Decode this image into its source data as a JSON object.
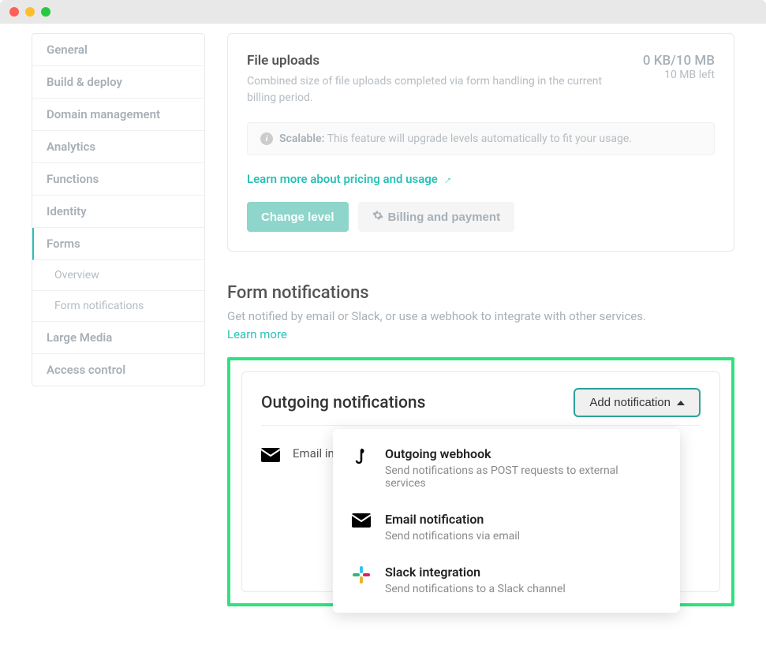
{
  "sidebar": {
    "items": [
      {
        "label": "General"
      },
      {
        "label": "Build & deploy"
      },
      {
        "label": "Domain management"
      },
      {
        "label": "Analytics"
      },
      {
        "label": "Functions"
      },
      {
        "label": "Identity"
      },
      {
        "label": "Forms"
      },
      {
        "label": "Large Media"
      },
      {
        "label": "Access control"
      }
    ],
    "sub_items": [
      {
        "label": "Overview"
      },
      {
        "label": "Form notifications"
      }
    ]
  },
  "uploads": {
    "title": "File uploads",
    "desc": "Combined size of file uploads completed via form handling in the current billing period.",
    "usage_main": "0 KB/10 MB",
    "usage_sub": "10 MB left",
    "scalable_label": "Scalable:",
    "scalable_desc": "This feature will upgrade levels automatically to fit your usage.",
    "learn_link": "Learn more about pricing and usage",
    "change_level": "Change level",
    "billing": "Billing and payment"
  },
  "notifications": {
    "section_title": "Form notifications",
    "section_desc": "Get notified by email or Slack, or use a webhook to integrate with other services.",
    "learn_more": "Learn more",
    "card_title": "Outgoing notifications",
    "add_button": "Add notification",
    "entry_text": "Email info form",
    "dropdown": [
      {
        "title": "Outgoing webhook",
        "desc": "Send notifications as POST requests to external services"
      },
      {
        "title": "Email notification",
        "desc": "Send notifications via email"
      },
      {
        "title": "Slack integration",
        "desc": "Send notifications to a Slack channel"
      }
    ]
  }
}
